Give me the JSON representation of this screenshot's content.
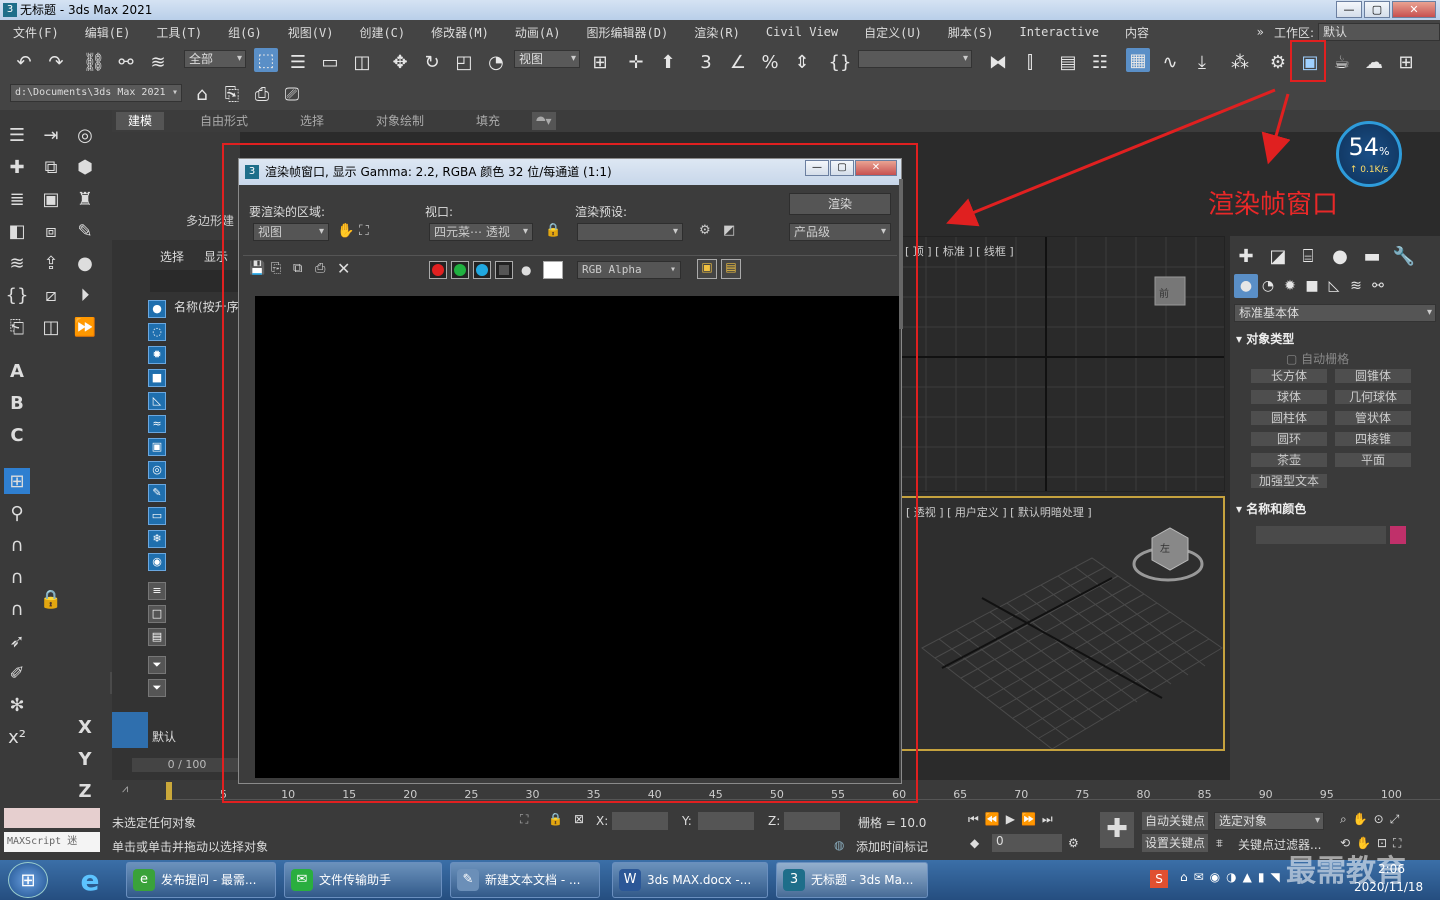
{
  "window": {
    "title": "无标题 - 3ds Max 2021",
    "app_icon": "3",
    "minimize": "—",
    "maximize": "▢",
    "close": "✕"
  },
  "menu": [
    "文件(F)",
    "编辑(E)",
    "工具(T)",
    "组(G)",
    "视图(V)",
    "创建(C)",
    "修改器(M)",
    "动画(A)",
    "图形编辑器(D)",
    "渲染(R)",
    "Civil View",
    "自定义(U)",
    "脚本(S)",
    "Interactive",
    "内容"
  ],
  "workspace": {
    "chevron": "»",
    "label": "工作区:",
    "value": "默认"
  },
  "toolbar": {
    "selection_filter": "全部",
    "ref_coord": "视图",
    "named_sel": ""
  },
  "path_bar": {
    "project_path": "d:\\Documents\\3ds Max 2021"
  },
  "ribbon": {
    "tabs": [
      "建模",
      "自由形式",
      "选择",
      "对象绘制",
      "填充"
    ],
    "active": 0,
    "group_label": "多边形建"
  },
  "scene_explorer": {
    "tab_select": "选择",
    "tab_display": "显示",
    "column": "名称(按升序",
    "layer_default": "默认"
  },
  "viewports": {
    "top_label": "[ 顶 ] [ 标准 ] [ 线框 ]",
    "persp_label": "[ 透视 ] [ 用户定义 ] [ 默认明暗处理 ]",
    "cube_face": "前",
    "cube_face_persp": "左"
  },
  "command_panel": {
    "category": "标准基本体",
    "section_object_type": "对象类型",
    "autogrid": "自动栅格",
    "objects": [
      "长方体",
      "圆锥体",
      "球体",
      "几何球体",
      "圆柱体",
      "管状体",
      "圆环",
      "四棱锥",
      "茶壶",
      "平面",
      "加强型文本"
    ],
    "section_name_color": "名称和颜色",
    "swatch_color": "#c0306a"
  },
  "gauge": {
    "percent": "54",
    "unit": "%",
    "rate": "0.1K/s"
  },
  "annotation": {
    "text": "渲染帧窗口",
    "color": "#e82828"
  },
  "render_window": {
    "title": "渲染帧窗口, 显示 Gamma: 2.2, RGBA 颜色 32 位/每通道 (1:1)",
    "area_label": "要渲染的区域:",
    "area_value": "视图",
    "viewport_label": "视口:",
    "viewport_value": "四元菜⋯ 透视",
    "preset_label": "渲染预设:",
    "preset_value": "",
    "render_button": "渲染",
    "quality_value": "产品级",
    "channel_value": "RGB Alpha",
    "channel_colors": [
      "#e02020",
      "#20b040",
      "#20a8e0"
    ]
  },
  "timeline": {
    "frame": "0 / 100",
    "ticks": [
      "5",
      "10",
      "15",
      "20",
      "25",
      "30",
      "35",
      "40",
      "45",
      "50",
      "55",
      "60",
      "65",
      "70",
      "75",
      "80",
      "85",
      "90",
      "95",
      "100"
    ]
  },
  "status": {
    "maxscript_label": "MAXScript 迷",
    "line1": "未选定任何对象",
    "line2": "单击或单击并拖动以选择对象",
    "x_label": "X:",
    "y_label": "Y:",
    "z_label": "Z:",
    "grid": "栅格 = 10.0",
    "add_time_tag": "添加时间标记",
    "auto_key": "自动关键点",
    "selected_object": "选定对象",
    "set_key": "设置关键点",
    "key_filter": "关键点过滤器...",
    "frame_field": "0"
  },
  "taskbar": {
    "items": [
      {
        "label": "发布提问 - 最需...",
        "icon_color": "#3aa23a",
        "icon": "e"
      },
      {
        "label": "文件传输助手",
        "icon_color": "#2aae3f",
        "icon": "✉"
      },
      {
        "label": "新建文本文档 - ...",
        "icon_color": "#6b8fb8",
        "icon": "✎"
      },
      {
        "label": "3ds MAX.docx -...",
        "icon_color": "#2b5797",
        "icon": "W"
      },
      {
        "label": "无标题 - 3ds Ma...",
        "icon_color": "#1e6e8a",
        "icon": "3"
      }
    ],
    "clock_time": "2:06",
    "clock_date": "2020/11/18",
    "watermark": "最需教育"
  }
}
